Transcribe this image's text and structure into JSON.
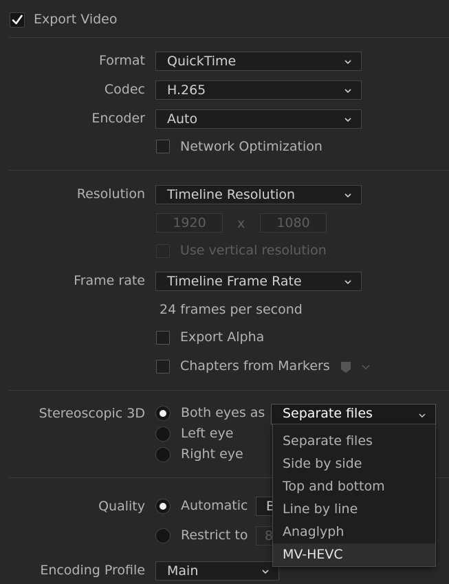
{
  "export_video": {
    "label": "Export Video",
    "checked": true
  },
  "format": {
    "label": "Format",
    "value": "QuickTime"
  },
  "codec": {
    "label": "Codec",
    "value": "H.265"
  },
  "encoder": {
    "label": "Encoder",
    "value": "Auto"
  },
  "network_optimization": {
    "label": "Network Optimization",
    "checked": false
  },
  "resolution": {
    "label": "Resolution",
    "value": "Timeline Resolution",
    "width": "1920",
    "separator": "x",
    "height": "1080"
  },
  "vertical_resolution": {
    "label": "Use vertical resolution",
    "checked": false,
    "disabled": true
  },
  "frame_rate": {
    "label": "Frame rate",
    "value": "Timeline Frame Rate",
    "info": "24 frames per second"
  },
  "export_alpha": {
    "label": "Export Alpha",
    "checked": false
  },
  "chapters_from_markers": {
    "label": "Chapters from Markers",
    "checked": false
  },
  "stereoscopic": {
    "label": "Stereoscopic 3D",
    "options": [
      "Both eyes as",
      "Left eye",
      "Right eye"
    ],
    "selected": "Both eyes as",
    "mode": "Separate files",
    "mode_options": [
      "Separate files",
      "Side by side",
      "Top and bottom",
      "Line by line",
      "Anaglyph",
      "MV-HEVC"
    ],
    "highlighted": "MV-HEVC"
  },
  "quality": {
    "label": "Quality",
    "options": [
      "Automatic",
      "Restrict to"
    ],
    "selected": "Automatic",
    "auto_value_partial": "B",
    "restrict_value_partial": "8"
  },
  "encoding_profile": {
    "label": "Encoding Profile",
    "value": "Main"
  },
  "colors": {
    "background": "#282828",
    "field": "#1d1d1d",
    "text": "#b3b3b3",
    "accent_check": "#ffffff"
  }
}
